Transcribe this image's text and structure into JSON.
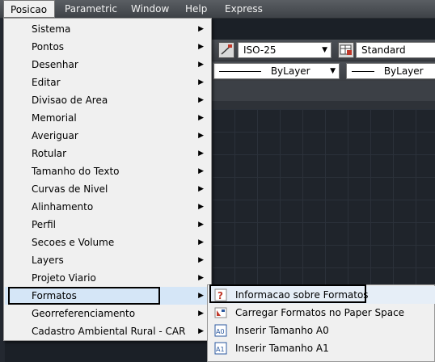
{
  "menubar": {
    "items": [
      "Posicao",
      "Parametric",
      "Window",
      "Help",
      "Express"
    ]
  },
  "toolbar": {
    "dim_style": "ISO-25",
    "table_style": "Standard",
    "linetype1": "ByLayer",
    "linetype2": "ByLayer"
  },
  "menu": {
    "items": [
      "Sistema",
      "Pontos",
      "Desenhar",
      "Editar",
      "Divisao de Area",
      "Memorial",
      "Averiguar",
      "Rotular",
      "Tamanho do Texto",
      "Curvas de Nivel",
      "Alinhamento",
      "Perfil",
      "Secoes e Volume",
      "Layers",
      "Projeto Viario",
      "Formatos",
      "Georreferenciamento",
      "Cadastro Ambiental Rural - CAR"
    ],
    "highlighted": "Formatos"
  },
  "submenu": {
    "items": [
      {
        "label": "Informacao sobre Formatos",
        "icon": "question-icon"
      },
      {
        "label": "Carregar Formatos no Paper Space",
        "icon": "paper-space-icon"
      },
      {
        "label": "Inserir Tamanho A0",
        "icon": "insert-a0-icon"
      },
      {
        "label": "Inserir Tamanho A1",
        "icon": "insert-a1-icon"
      }
    ]
  },
  "colors": {
    "menu_bg": "#f0f0f0",
    "highlight": "#d5e6f7",
    "menubar_bg": "#4a4e53",
    "canvas_bg": "#1f242b"
  }
}
